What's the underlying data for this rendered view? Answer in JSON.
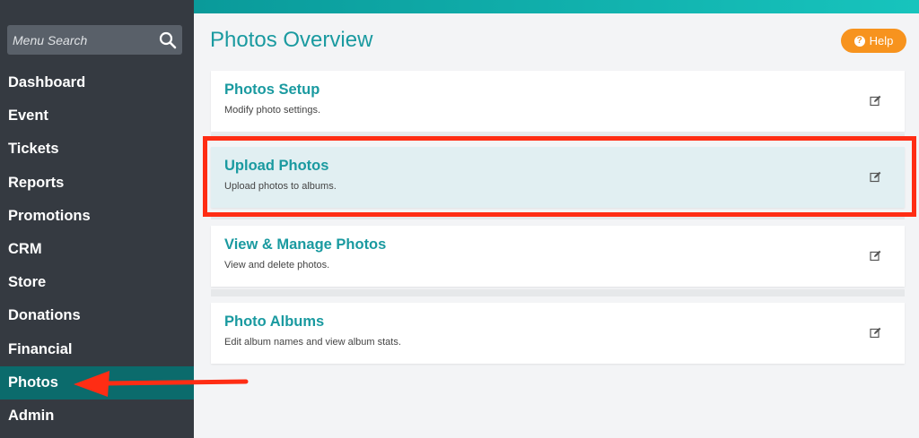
{
  "sidebar": {
    "search": {
      "placeholder": "Menu Search",
      "icon": "search-icon"
    },
    "items": [
      {
        "label": "Dashboard"
      },
      {
        "label": "Event"
      },
      {
        "label": "Tickets"
      },
      {
        "label": "Reports"
      },
      {
        "label": "Promotions"
      },
      {
        "label": "CRM"
      },
      {
        "label": "Store"
      },
      {
        "label": "Donations"
      },
      {
        "label": "Financial"
      },
      {
        "label": "Photos",
        "active": true
      },
      {
        "label": "Admin"
      }
    ]
  },
  "header": {
    "title": "Photos Overview",
    "help_label": "Help",
    "help_icon": "question-circle-icon"
  },
  "cards": [
    {
      "title": "Photos Setup",
      "desc": "Modify photo settings.",
      "icon": "edit-icon"
    },
    {
      "title": "Upload Photos",
      "desc": "Upload photos to albums.",
      "icon": "edit-icon",
      "highlighted": true
    },
    {
      "title": "View & Manage Photos",
      "desc": "View and delete photos.",
      "icon": "edit-icon"
    },
    {
      "title": "Photo Albums",
      "desc": "Edit album names and view album stats.",
      "icon": "edit-icon"
    }
  ],
  "colors": {
    "sidebar_bg": "#353a41",
    "active_nav": "#0b6b6c",
    "accent_teal": "#1a9aa0",
    "help_orange": "#f7931e",
    "highlight_card": "#e1eff2",
    "annotation_red": "#ff2d14"
  }
}
